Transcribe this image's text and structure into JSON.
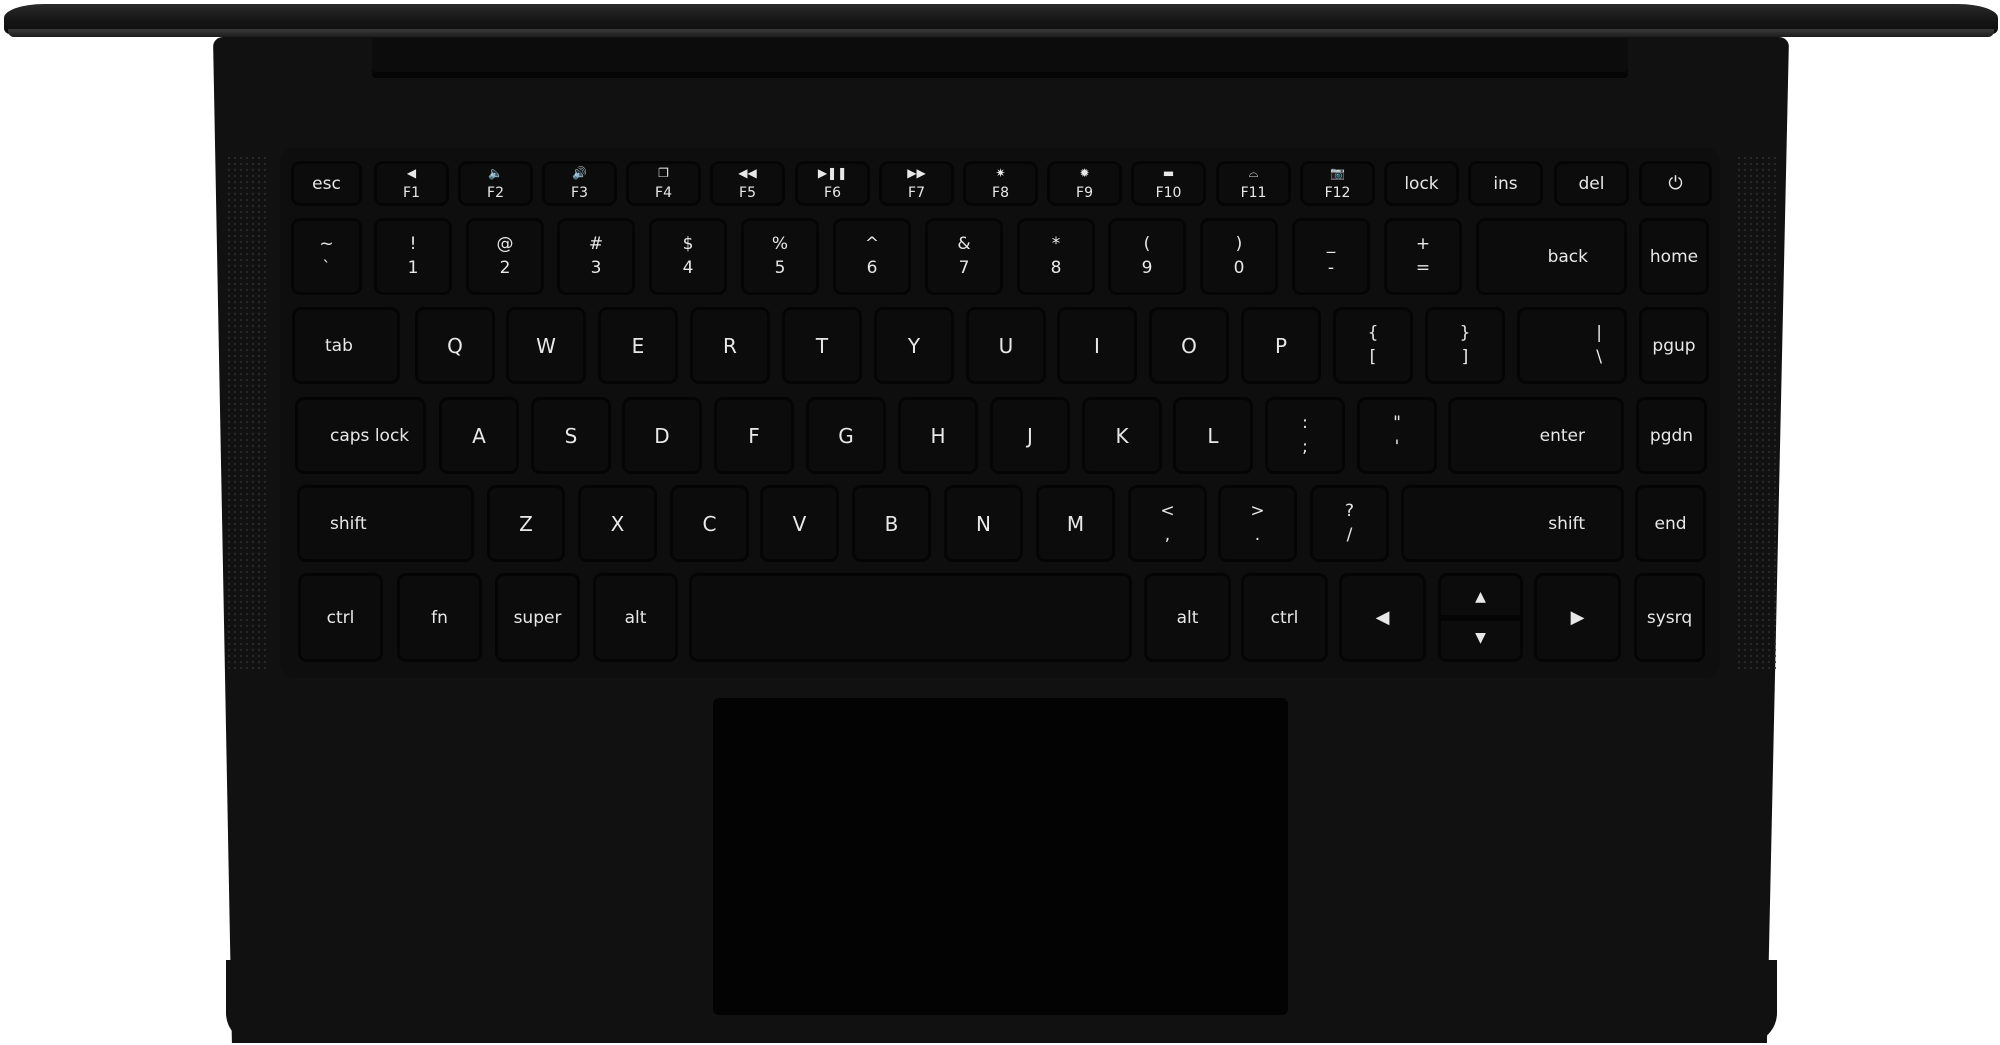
{
  "device": "laptop keyboard top view",
  "colors": {
    "body": "#111112",
    "key": "#0c0c0c",
    "label": "#e8e8e8",
    "trackpad": "#030303"
  },
  "rows": {
    "function": [
      {
        "label": "esc"
      },
      {
        "icon": "◀",
        "sub": "F1",
        "icon_name": "mute-icon"
      },
      {
        "icon": "🔈",
        "sub": "F2",
        "icon_name": "volume-down-icon"
      },
      {
        "icon": "🔊",
        "sub": "F3",
        "icon_name": "volume-up-icon"
      },
      {
        "icon": "❐",
        "sub": "F4",
        "icon_name": "switch-window-icon"
      },
      {
        "icon": "◀◀",
        "sub": "F5",
        "icon_name": "rewind-icon"
      },
      {
        "icon": "▶❚❚",
        "sub": "F6",
        "icon_name": "play-pause-icon"
      },
      {
        "icon": "▶▶",
        "sub": "F7",
        "icon_name": "fast-forward-icon"
      },
      {
        "icon": "✷",
        "sub": "F8",
        "icon_name": "brightness-down-icon"
      },
      {
        "icon": "✹",
        "sub": "F9",
        "icon_name": "brightness-up-icon"
      },
      {
        "icon": "▬",
        "sub": "F10",
        "icon_name": "display-icon"
      },
      {
        "icon": "⌓",
        "sub": "F11",
        "icon_name": "keyboard-backlight-icon"
      },
      {
        "icon": "📷",
        "sub": "F12",
        "icon_name": "camera-icon"
      },
      {
        "label": "lock"
      },
      {
        "label": "ins"
      },
      {
        "label": "del"
      },
      {
        "icon": "⏻",
        "icon_name": "power-icon"
      }
    ],
    "number": [
      {
        "top": "~",
        "bot": "`"
      },
      {
        "top": "!",
        "bot": "1"
      },
      {
        "top": "@",
        "bot": "2"
      },
      {
        "top": "#",
        "bot": "3"
      },
      {
        "top": "$",
        "bot": "4"
      },
      {
        "top": "%",
        "bot": "5"
      },
      {
        "top": "^",
        "bot": "6"
      },
      {
        "top": "&",
        "bot": "7"
      },
      {
        "top": "*",
        "bot": "8"
      },
      {
        "top": "(",
        "bot": "9"
      },
      {
        "top": ")",
        "bot": "0"
      },
      {
        "top": "_",
        "bot": "-"
      },
      {
        "top": "+",
        "bot": "="
      },
      {
        "label": "back"
      },
      {
        "label": "home"
      }
    ],
    "tab": [
      {
        "label": "tab"
      },
      {
        "label": "Q"
      },
      {
        "label": "W"
      },
      {
        "label": "E"
      },
      {
        "label": "R"
      },
      {
        "label": "T"
      },
      {
        "label": "Y"
      },
      {
        "label": "U"
      },
      {
        "label": "I"
      },
      {
        "label": "O"
      },
      {
        "label": "P"
      },
      {
        "top": "{",
        "bot": "["
      },
      {
        "top": "}",
        "bot": "]"
      },
      {
        "top": "|",
        "bot": "\\"
      },
      {
        "label": "pgup"
      }
    ],
    "caps": [
      {
        "label": "caps lock"
      },
      {
        "label": "A"
      },
      {
        "label": "S"
      },
      {
        "label": "D"
      },
      {
        "label": "F"
      },
      {
        "label": "G"
      },
      {
        "label": "H"
      },
      {
        "label": "J"
      },
      {
        "label": "K"
      },
      {
        "label": "L"
      },
      {
        "top": ":",
        "bot": ";"
      },
      {
        "top": "\"",
        "bot": "'"
      },
      {
        "label": "enter"
      },
      {
        "label": "pgdn"
      }
    ],
    "shift": [
      {
        "label": "shift"
      },
      {
        "label": "Z"
      },
      {
        "label": "X"
      },
      {
        "label": "C"
      },
      {
        "label": "V"
      },
      {
        "label": "B"
      },
      {
        "label": "N"
      },
      {
        "label": "M"
      },
      {
        "top": "<",
        "bot": ","
      },
      {
        "top": ">",
        "bot": "."
      },
      {
        "top": "?",
        "bot": "/"
      },
      {
        "label": "shift"
      },
      {
        "label": "end"
      }
    ],
    "bottom": [
      {
        "label": "ctrl"
      },
      {
        "label": "fn"
      },
      {
        "label": "super"
      },
      {
        "label": "alt"
      },
      {
        "label": ""
      },
      {
        "label": "alt"
      },
      {
        "label": "ctrl"
      },
      {
        "icon": "◀",
        "icon_name": "arrow-left-icon"
      },
      {
        "up": "▲",
        "down": "▼"
      },
      {
        "icon": "▶",
        "icon_name": "arrow-right-icon"
      },
      {
        "label": "sysrq"
      }
    ]
  }
}
